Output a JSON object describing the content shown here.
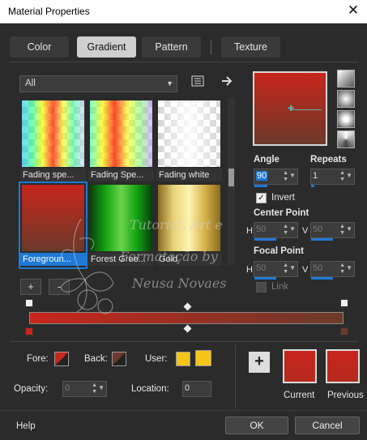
{
  "window": {
    "title": "Material Properties"
  },
  "tabs": [
    {
      "label": "Color"
    },
    {
      "label": "Gradient"
    },
    {
      "label": "Pattern"
    },
    {
      "label": "Texture"
    }
  ],
  "gradient_category": {
    "selected": "All"
  },
  "gradients": [
    {
      "label": "Fading spe..."
    },
    {
      "label": "Fading Spe..."
    },
    {
      "label": "Fading white"
    },
    {
      "label": "Foregroun..."
    },
    {
      "label": "Forest Gree..."
    },
    {
      "label": "Gold"
    }
  ],
  "angle": {
    "label": "Angle",
    "value": "90"
  },
  "repeats": {
    "label": "Repeats",
    "value": "1"
  },
  "invert": {
    "label": "Invert",
    "checked": true
  },
  "center_point": {
    "label": "Center Point",
    "h_label": "H",
    "h_value": "50",
    "v_label": "V",
    "v_value": "50"
  },
  "focal_point": {
    "label": "Focal Point",
    "h_label": "H",
    "h_value": "50",
    "v_label": "V",
    "v_value": "50"
  },
  "link": {
    "label": "Link",
    "checked": false
  },
  "stops_buttons": {
    "add": "+",
    "remove": "-"
  },
  "fore": {
    "label": "Fore:",
    "color": "#c8251b"
  },
  "back": {
    "label": "Back:",
    "color": "#6b3a2a"
  },
  "user": {
    "label": "User:",
    "color": "#f5c518"
  },
  "opacity": {
    "label": "Opacity:",
    "value": "0"
  },
  "location": {
    "label": "Location:",
    "value": "0"
  },
  "current": {
    "label": "Current"
  },
  "previous": {
    "label": "Previous"
  },
  "buttons": {
    "help": "Help",
    "ok": "OK",
    "cancel": "Cancel"
  },
  "watermark": {
    "line1": "Tutorial, Art e",
    "line2": "Formatação by",
    "line3": "Neusa Novaes"
  },
  "colors": {
    "accent": "#1e7ad6",
    "red": "#c8251b",
    "brown": "#6b3a2a"
  }
}
